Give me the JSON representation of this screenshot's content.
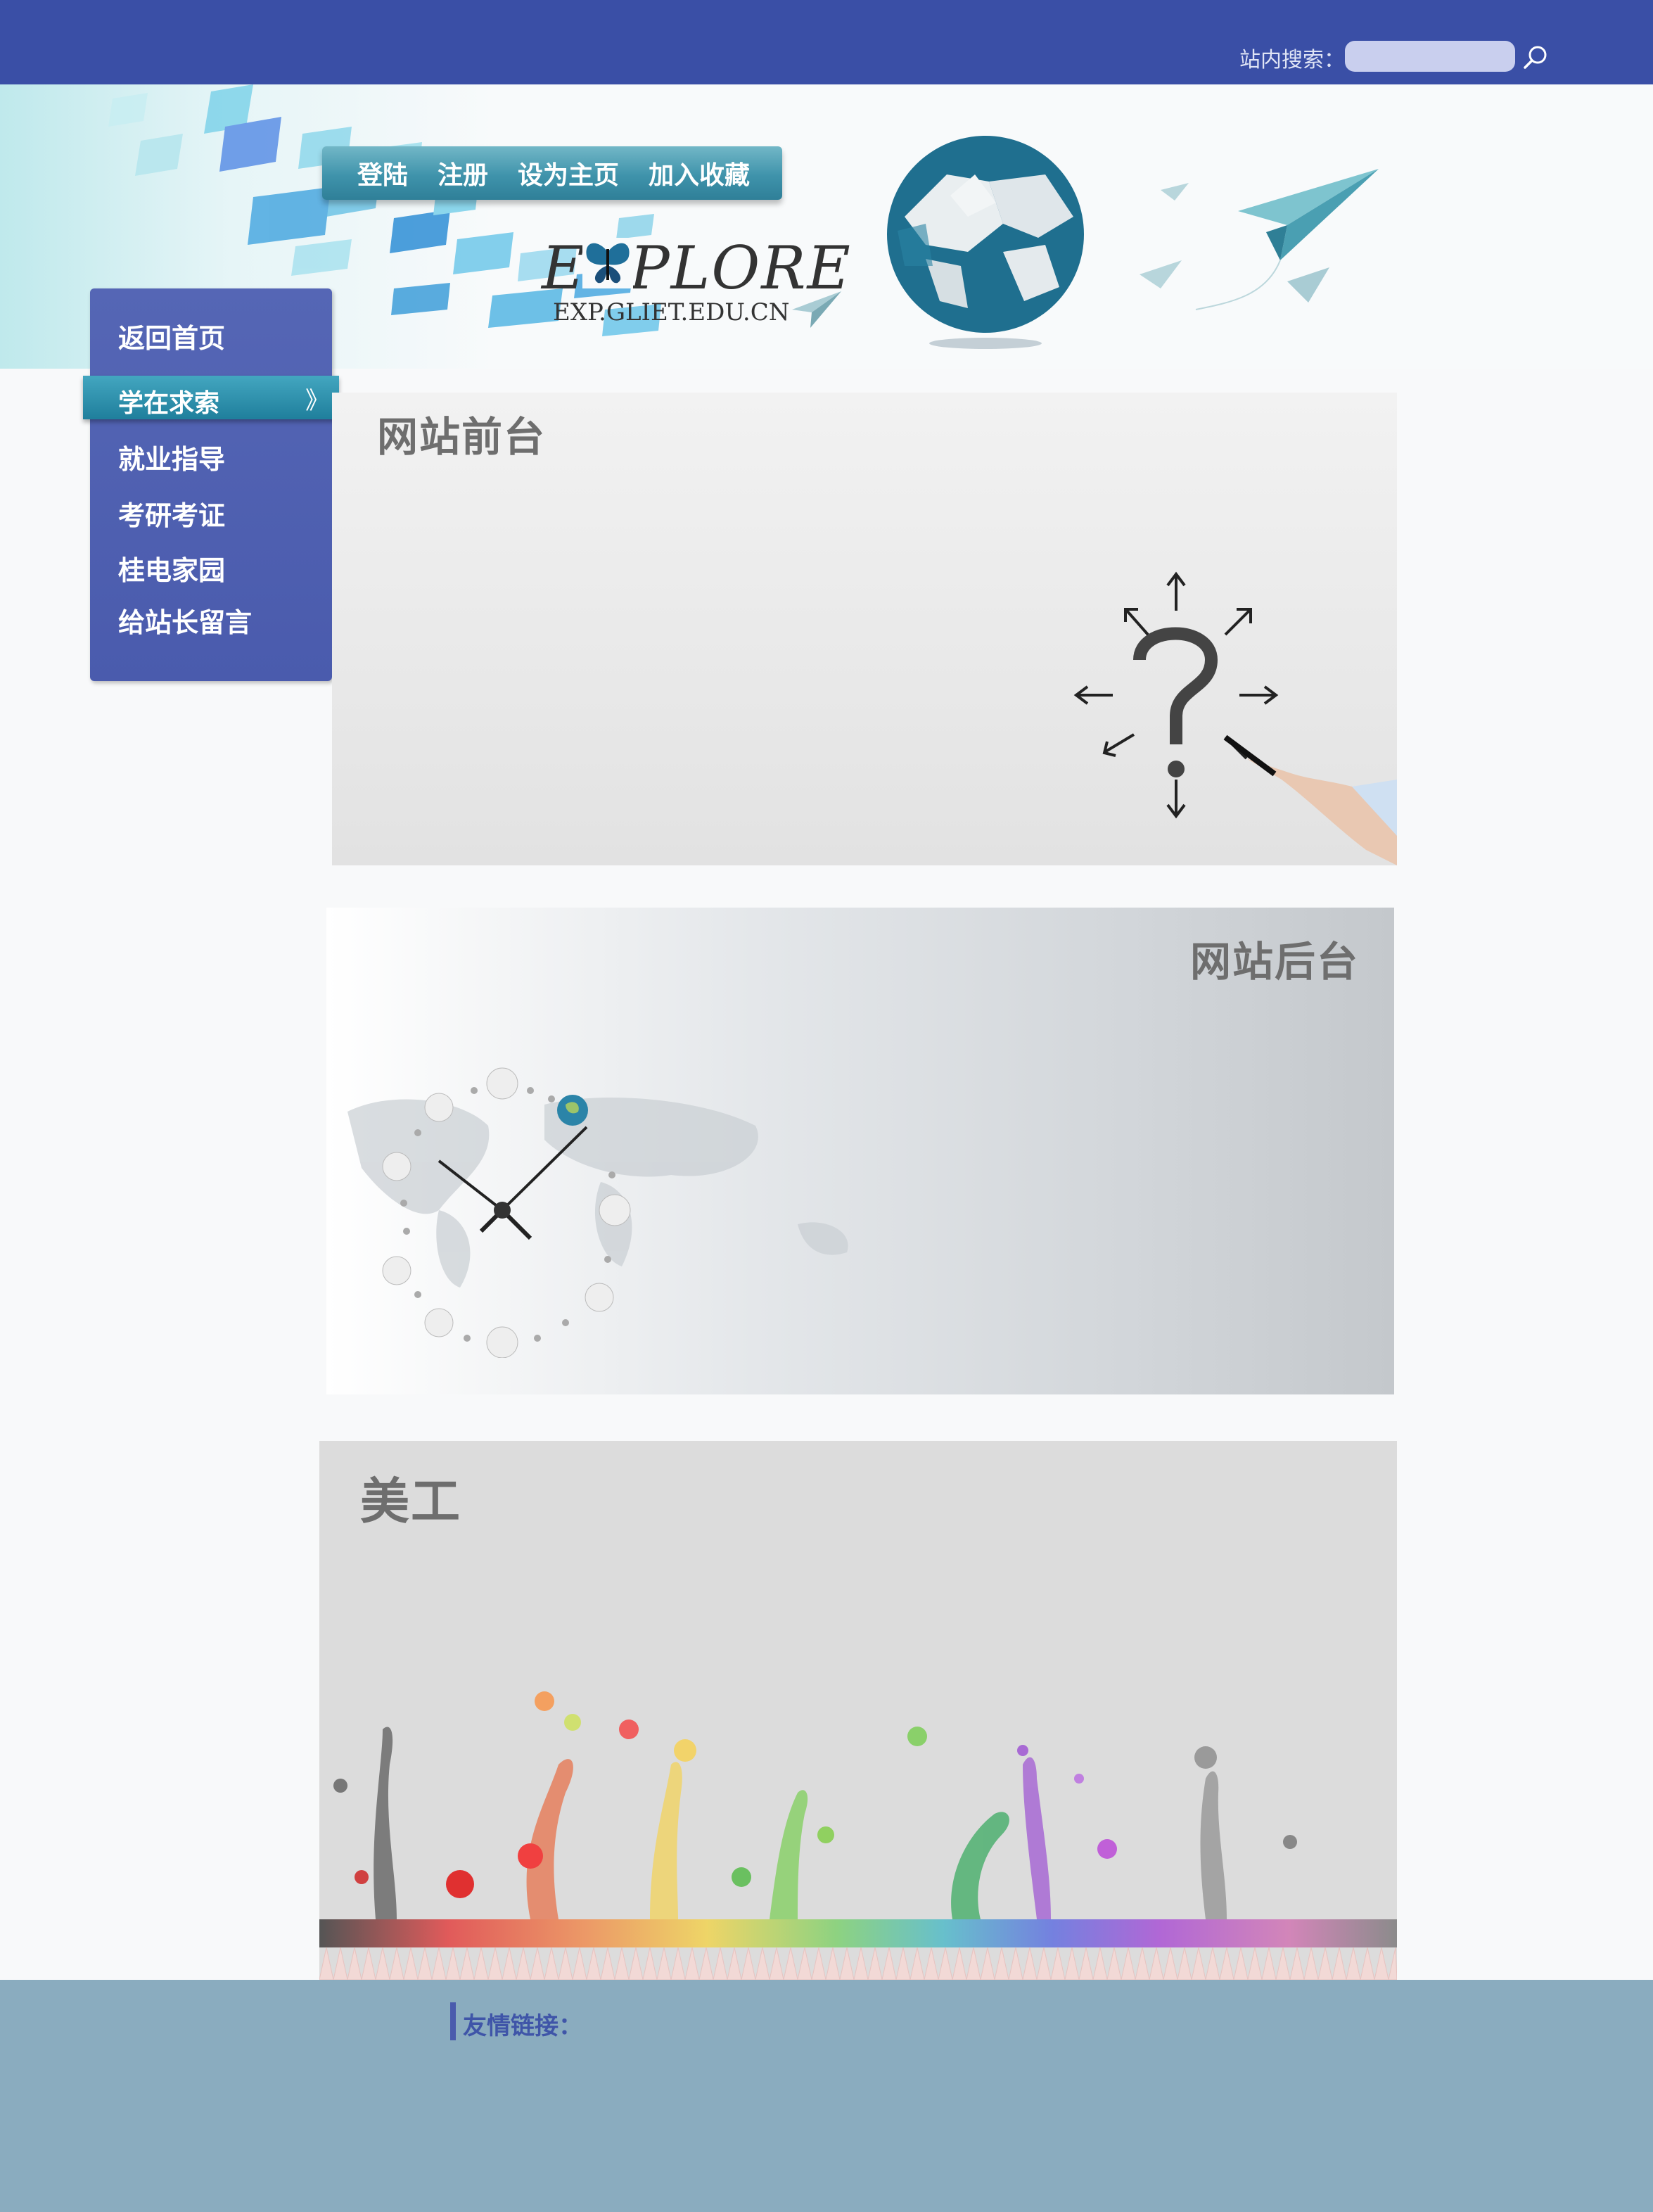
{
  "search": {
    "label": "站内搜索：",
    "placeholder": "",
    "value": ""
  },
  "top_nav": [
    "登陆",
    "注册",
    "设为主页",
    "加入收藏"
  ],
  "logo": {
    "word": "EXPLORE",
    "domain": "EXP.GLIET.EDU.CN"
  },
  "sidebar": {
    "items": [
      "返回首页",
      "学在求索",
      "就业指导",
      "考研考证",
      "桂电家园",
      "给站长留言"
    ],
    "active_arrow": "》"
  },
  "panels": {
    "p1_title": "网站前台",
    "p2_title": "网站后台",
    "p3_title": "美工"
  },
  "footer": {
    "links_label": "友情链接："
  },
  "colors": {
    "topbar": "#3a4fa6",
    "sidebar": "#4a5bad",
    "sidebar_active": "#2a8aa6",
    "footer": "#8aacbf",
    "footer_label": "#3f55a8"
  },
  "icons": [
    "search-icon",
    "globe-icon",
    "paper-plane-icon",
    "question-mark-icon",
    "clock-icon",
    "butterfly-icon"
  ]
}
